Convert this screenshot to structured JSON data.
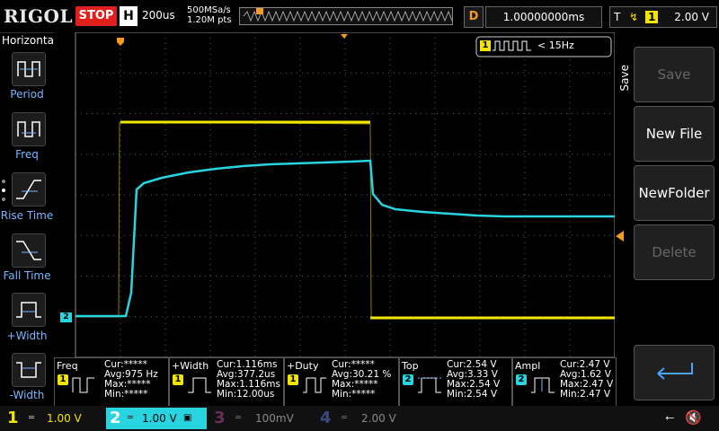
{
  "brand": "RIGOL",
  "run_state": "STOP",
  "horizontal": {
    "label": "H",
    "timebase": "200us",
    "sample_rate": "500MSa/s",
    "points": "1.20M pts"
  },
  "delay": {
    "label": "D",
    "value": "1.00000000ms"
  },
  "trigger": {
    "label": "T",
    "source": "1",
    "level": "2.00 V"
  },
  "left_menu": {
    "title": "Horizontal",
    "items": [
      {
        "label": "Period"
      },
      {
        "label": "Freq"
      },
      {
        "label": "Rise Time"
      },
      {
        "label": "Fall Time"
      },
      {
        "label": "+Width"
      },
      {
        "label": "-Width"
      }
    ]
  },
  "counter": {
    "channel": "1",
    "value": "< 15Hz"
  },
  "right_menu": {
    "title": "Save",
    "buttons": [
      {
        "label": "Save",
        "enabled": false
      },
      {
        "label": "New File",
        "enabled": true
      },
      {
        "label": "NewFolder",
        "enabled": true
      },
      {
        "label": "Delete",
        "enabled": false
      }
    ],
    "enter_icon": "enter-arrow-icon"
  },
  "measurements": [
    {
      "name": "Freq",
      "channel": "1",
      "cur": "Cur:*****",
      "avg": "Avg:975 Hz",
      "max": "Max:*****",
      "min": "Min:*****"
    },
    {
      "name": "+Width",
      "channel": "1",
      "cur": "Cur:1.116ms",
      "avg": "Avg:377.2us",
      "max": "Max:1.116ms",
      "min": "Min:12.00us"
    },
    {
      "name": "+Duty",
      "channel": "1",
      "cur": "Cur:*****",
      "avg": "Avg:30.21 %",
      "max": "Max:*****",
      "min": "Min:*****"
    },
    {
      "name": "Top",
      "channel": "2",
      "cur": "Cur:2.54 V",
      "avg": "Avg:3.33 V",
      "max": "Max:2.54 V",
      "min": "Min:2.54 V"
    },
    {
      "name": "Ampl",
      "channel": "2",
      "cur": "Cur:2.47 V",
      "avg": "Avg:1.62 V",
      "max": "Max:2.47 V",
      "min": "Min:2.47 V"
    }
  ],
  "channels": [
    {
      "num": "1",
      "scale": "1.00 V",
      "color": "#f2e600",
      "active": true
    },
    {
      "num": "2",
      "scale": "1.00 V",
      "color": "#27d4e0",
      "active": true
    },
    {
      "num": "3",
      "scale": "100mV",
      "color": "#c02b8c",
      "active": false
    },
    {
      "num": "4",
      "scale": "2.00 V",
      "color": "#2f5ed9",
      "active": false
    }
  ],
  "ch2_marker": "2",
  "colors": {
    "ch1": "#f2e600",
    "ch2": "#27d4e0",
    "trigger": "#f59a23",
    "stop": "#e0201b"
  }
}
